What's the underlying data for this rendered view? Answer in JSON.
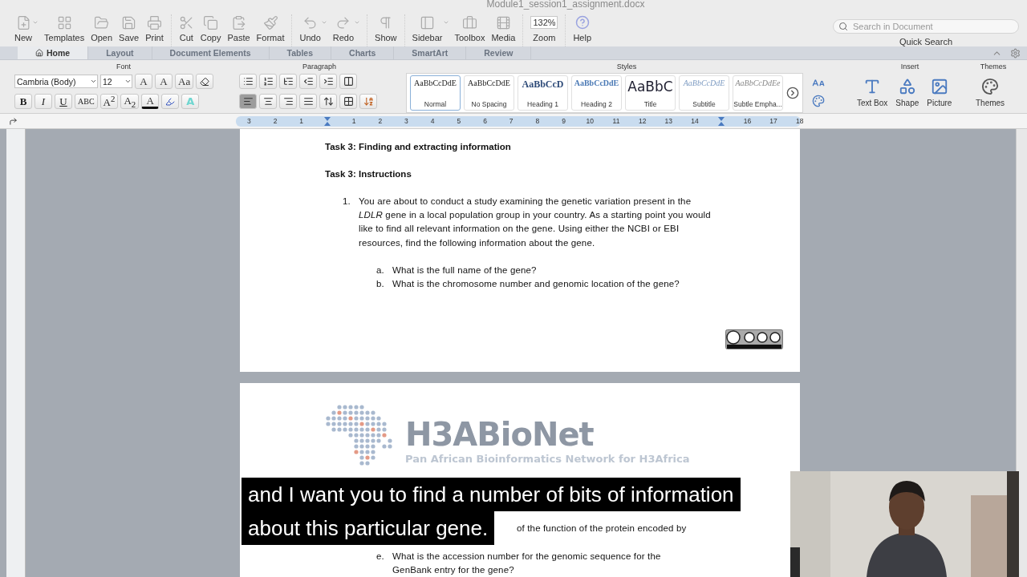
{
  "window": {
    "title": "Module1_session1_assignment.docx"
  },
  "toolbar": {
    "buttons": [
      {
        "label": "New",
        "menu": true
      },
      {
        "label": "Templates",
        "menu": false
      },
      {
        "label": "Open",
        "menu": false
      },
      {
        "label": "Save",
        "menu": false
      },
      {
        "label": "Print",
        "menu": false
      },
      {
        "label": "Cut",
        "menu": false
      },
      {
        "label": "Copy",
        "menu": false
      },
      {
        "label": "Paste",
        "menu": false
      },
      {
        "label": "Format",
        "menu": false
      },
      {
        "label": "Undo",
        "menu": true
      },
      {
        "label": "Redo",
        "menu": true
      },
      {
        "label": "Show",
        "menu": false
      },
      {
        "label": "Sidebar",
        "menu": true
      },
      {
        "label": "Toolbox",
        "menu": false
      },
      {
        "label": "Media",
        "menu": false
      }
    ],
    "zoom": {
      "value": "132%",
      "label": "Zoom"
    },
    "help": "Help",
    "search": {
      "placeholder": "Search in Document",
      "label": "Quick Search"
    }
  },
  "tabs": [
    {
      "label": "Home",
      "selected": true
    },
    {
      "label": "Layout",
      "selected": false
    },
    {
      "label": "Document Elements",
      "selected": false
    },
    {
      "label": "Tables",
      "selected": false
    },
    {
      "label": "Charts",
      "selected": false
    },
    {
      "label": "SmartArt",
      "selected": false
    },
    {
      "label": "Review",
      "selected": false
    }
  ],
  "ribbon": {
    "font": {
      "title": "Font",
      "family": "Cambria (Body)",
      "size": "12",
      "size_buttons": [
        "A",
        "A"
      ],
      "case_button": "Aa",
      "format_buttons": [
        "B",
        "I",
        "U",
        "ABC",
        "A$^{2}$",
        "A$_{2}$"
      ],
      "color_buttons": [
        "A",
        "A"
      ]
    },
    "paragraph": {
      "title": "Paragraph",
      "alignment": [
        {
          "kind": "left",
          "selected": true
        },
        {
          "kind": "center",
          "selected": false
        },
        {
          "kind": "right",
          "selected": false
        },
        {
          "kind": "justify",
          "selected": false
        }
      ]
    },
    "styles": {
      "title": "Styles",
      "items": [
        {
          "preview": "AaBbCcDdE",
          "name": "Normal",
          "kind": "normal",
          "selected": true
        },
        {
          "preview": "AaBbCcDdE",
          "name": "No Spacing",
          "kind": "normal",
          "selected": false
        },
        {
          "preview": "AaBbCcD",
          "name": "Heading 1",
          "kind": "heading1",
          "selected": false
        },
        {
          "preview": "AaBbCcDdE",
          "name": "Heading 2",
          "kind": "heading2",
          "selected": false
        },
        {
          "preview": "AaBbC",
          "name": "Title",
          "kind": "title",
          "selected": false
        },
        {
          "preview": "AaBbCcDdE",
          "name": "Subtitle",
          "kind": "subtitle",
          "selected": false
        },
        {
          "preview": "AaBbCcDdEe",
          "name": "Subtle Empha...",
          "kind": "emphasis",
          "selected": false
        }
      ]
    },
    "insert": {
      "title": "Insert",
      "items": [
        "Text Box",
        "Shape",
        "Picture"
      ]
    },
    "themes": {
      "title": "Themes",
      "label": "Themes"
    }
  },
  "ruler": {
    "marks": [
      {
        "kind": "number",
        "text": "3"
      },
      {
        "kind": "number",
        "text": "2"
      },
      {
        "kind": "number",
        "text": "1"
      },
      {
        "kind": "indent"
      },
      {
        "kind": "number",
        "text": "1"
      },
      {
        "kind": "number",
        "text": "2"
      },
      {
        "kind": "number",
        "text": "3"
      },
      {
        "kind": "number",
        "text": "4"
      },
      {
        "kind": "number",
        "text": "5"
      },
      {
        "kind": "number",
        "text": "6"
      },
      {
        "kind": "number",
        "text": "7"
      },
      {
        "kind": "number",
        "text": "8"
      },
      {
        "kind": "number",
        "text": "9"
      },
      {
        "kind": "number",
        "text": "10"
      },
      {
        "kind": "number",
        "text": "11"
      },
      {
        "kind": "number",
        "text": "12"
      },
      {
        "kind": "number",
        "text": "13"
      },
      {
        "kind": "number",
        "text": "14"
      },
      {
        "kind": "indent"
      },
      {
        "kind": "number",
        "text": "16"
      },
      {
        "kind": "number",
        "text": "17"
      },
      {
        "kind": "number",
        "text": "18"
      }
    ]
  },
  "page_1": {
    "headings": [
      "Task 3: Finding and extracting information",
      "Task 3: Instructions"
    ],
    "list": [
      {
        "number": "1.",
        "text": "You are about to conduct a study examining the genetic variation present in the *LDLR* gene in a local population group in your country. As a starting point you would like to find all relevant information on the gene. Using either the NCBI or EBI resources, find the following information about the gene.",
        "children": [
          {
            "number": "a.",
            "text": "What is the full name of the gene?"
          },
          {
            "number": "b.",
            "text": "What is the chromosome number and genomic location of the gene?"
          }
        ]
      }
    ]
  },
  "page_2": {
    "logo": {
      "name": "H3ABioNet",
      "tagline": "Pan African Bioinformatics Network for H3Africa"
    },
    "list": [
      {
        "text": "of the function of the protein encoded by"
      },
      {
        "number": "e.",
        "text": "What is the accession number for the genomic sequence for the GenBank entry for the gene?"
      }
    ]
  },
  "subtitle": {
    "lines": [
      "and I want you to find a number of bits of information",
      "about this particular gene."
    ]
  }
}
